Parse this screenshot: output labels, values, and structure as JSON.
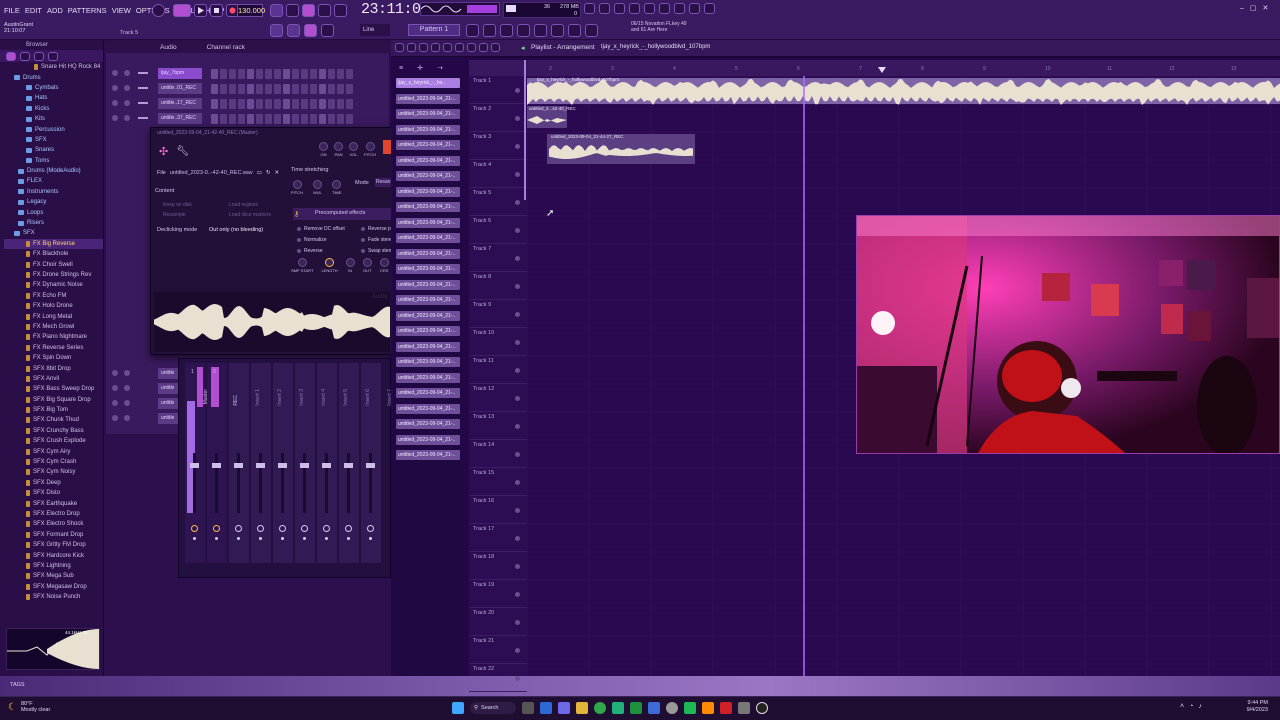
{
  "app": {
    "menu": [
      "FILE",
      "EDIT",
      "ADD",
      "PATTERNS",
      "VIEW",
      "OPTIONS",
      "TOOLS",
      "HELP"
    ],
    "user": "AustinGrant",
    "user_time": "21:10:07",
    "track_hint": "Track 5",
    "tempo": "130.000",
    "clock": "23:11:06",
    "monitor_a": "36",
    "monitor_b": "278 MB",
    "monitor_c": "0",
    "pattern": "Pattern 1",
    "snap": "Line",
    "hint": [
      "06/15  Novation FLkey 49",
      "and 61 Are Here"
    ]
  },
  "browser": {
    "title": "Browser",
    "items": [
      {
        "label": "Snare Hit HQ Rock 84",
        "type": "file"
      },
      {
        "label": "Drums",
        "type": "folder"
      },
      {
        "label": "Cymbals",
        "type": "folder"
      },
      {
        "label": "Hats",
        "type": "folder"
      },
      {
        "label": "Kicks",
        "type": "folder"
      },
      {
        "label": "Kits",
        "type": "folder"
      },
      {
        "label": "Percussion",
        "type": "folder"
      },
      {
        "label": "SFX",
        "type": "folder"
      },
      {
        "label": "Snares",
        "type": "folder"
      },
      {
        "label": "Toms",
        "type": "folder"
      },
      {
        "label": "Drums (ModeAudio)",
        "type": "folder"
      },
      {
        "label": "FLEX",
        "type": "folder"
      },
      {
        "label": "Instruments",
        "type": "folder"
      },
      {
        "label": "Legacy",
        "type": "folder"
      },
      {
        "label": "Loops",
        "type": "folder"
      },
      {
        "label": "Risers",
        "type": "folder"
      },
      {
        "label": "SFX",
        "type": "folder"
      },
      {
        "label": "FX Big Reverse",
        "type": "file",
        "selected": true
      },
      {
        "label": "FX Blackhole",
        "type": "file"
      },
      {
        "label": "FX Choir Swell",
        "type": "file"
      },
      {
        "label": "FX Drone Strings Rev",
        "type": "file"
      },
      {
        "label": "FX Dynamic Noise",
        "type": "file"
      },
      {
        "label": "FX Echo FM",
        "type": "file"
      },
      {
        "label": "FX Holo Drone",
        "type": "file"
      },
      {
        "label": "FX Long Metal",
        "type": "file"
      },
      {
        "label": "FX Mech Growl",
        "type": "file"
      },
      {
        "label": "FX Piano Nightmare",
        "type": "file"
      },
      {
        "label": "FX Reverse Series",
        "type": "file"
      },
      {
        "label": "FX Spin Down",
        "type": "file"
      },
      {
        "label": "SFX 8bit Drop",
        "type": "file"
      },
      {
        "label": "SFX Anvil",
        "type": "file"
      },
      {
        "label": "SFX Bass Sweep Drop",
        "type": "file"
      },
      {
        "label": "SFX Big Square Drop",
        "type": "file"
      },
      {
        "label": "SFX Big Tom",
        "type": "file"
      },
      {
        "label": "SFX Chunk Thud",
        "type": "file"
      },
      {
        "label": "SFX Crunchy Bass",
        "type": "file"
      },
      {
        "label": "SFX Crush Explode",
        "type": "file"
      },
      {
        "label": "SFX Cym Airy",
        "type": "file"
      },
      {
        "label": "SFX Cym Crash",
        "type": "file"
      },
      {
        "label": "SFX Cym Noisy",
        "type": "file"
      },
      {
        "label": "SFX Deep",
        "type": "file"
      },
      {
        "label": "SFX Disto",
        "type": "file"
      },
      {
        "label": "SFX Earthquake",
        "type": "file"
      },
      {
        "label": "SFX Electro Drop",
        "type": "file"
      },
      {
        "label": "SFX Electro Shock",
        "type": "file"
      },
      {
        "label": "SFX Formant Drop",
        "type": "file"
      },
      {
        "label": "SFX Gritty FM Drop",
        "type": "file"
      },
      {
        "label": "SFX Hardcore Kick",
        "type": "file"
      },
      {
        "label": "SFX Lightning",
        "type": "file"
      },
      {
        "label": "SFX Mega Sub",
        "type": "file"
      },
      {
        "label": "SFX Megasaw Drop",
        "type": "file"
      },
      {
        "label": "SFX Noise Punch",
        "type": "file"
      }
    ],
    "preview_info": "44.1kHz 32",
    "tags_label": "TAGS"
  },
  "channel_rack": {
    "tabs": [
      "Audio",
      "Channel rack"
    ],
    "rows": [
      "tjay_7bpm",
      "untitle..01_REC",
      "untitle..17_REC",
      "untitle..37_REC"
    ],
    "lower_rows": [
      "untitle",
      "untitle",
      "untitle",
      "untitle"
    ]
  },
  "sampler": {
    "title": "untitled_2023-09-04_21-42-40_REC (Master)",
    "file_label": "File",
    "file_name": "untitled_2023-0..-42-40_REC.wav",
    "knobs": [
      "PITCH",
      "MUL",
      "TIME"
    ],
    "top_knobs": [
      "ON",
      "PAN",
      "VOL",
      "PITCH"
    ],
    "content": "Content",
    "keep_on_disk": "Keep on disk",
    "resample": "Resample",
    "load_regions": "Load regions",
    "load_slice": "Load slice markers",
    "declick": "Declicking mode",
    "declick_value": "Out only (no bleeding)",
    "time_stretch": "Time stretching",
    "mode": "Mode",
    "resample_btn": "Resan",
    "precomputed": "Precomputed effects",
    "effects_left": [
      "Remove DC offset",
      "Normalize",
      "Reverse"
    ],
    "effects_right": [
      "Reverse p",
      "Fade stere",
      "Swap sten"
    ],
    "env_labels": [
      "SMP START",
      "LENGTH",
      "IN",
      "OUT",
      "CRS"
    ],
    "wave_watermark": "Audio"
  },
  "mixer": {
    "master": "Master",
    "insert": "REC",
    "inserts": [
      "Insert 1",
      "Insert 2",
      "Insert 3",
      "Insert 4",
      "Insert 5",
      "Insert 6",
      "Insert 7"
    ],
    "numbers": [
      "1",
      "2"
    ]
  },
  "playlist": {
    "title": "Playlist - Arrangement",
    "breadcrumb": "tjay_x_heyrick_-_hollywoodblvd_107bpm",
    "picker": [
      "tjay_x_heyrick_-_ho..",
      "untitled_2023-09-04_21-..",
      "untitled_2023-09-04_21-..",
      "untitled_2023-09-04_21-..",
      "untitled_2023-09-04_21-..",
      "untitled_2023-09-04_21-..",
      "untitled_2023-09-04_21-..",
      "untitled_2023-09-04_21-..",
      "untitled_2023-09-04_21-..",
      "untitled_2023-09-04_21-..",
      "untitled_2023-09-04_21-..",
      "untitled_2023-09-04_21-..",
      "untitled_2023-09-04_21-..",
      "untitled_2023-09-04_21-..",
      "untitled_2023-09-04_21-..",
      "untitled_2023-09-04_21-..",
      "untitled_2023-09-04_21-..",
      "untitled_2023-09-04_21-..",
      "untitled_2023-09-04_21-..",
      "untitled_2023-09-04_21-..",
      "untitled_2023-09-04_21-..",
      "untitled_2023-09-04_21-..",
      "untitled_2023-09-04_21-..",
      "untitled_2023-09-04_21-..",
      "untitled_2023-09-04_21-.."
    ],
    "tracks": [
      "Track 1",
      "Track 2",
      "Track 3",
      "Track 4",
      "Track 5",
      "Track 6",
      "Track 7",
      "Track 8",
      "Track 9",
      "Track 10",
      "Track 11",
      "Track 12",
      "Track 13",
      "Track 14",
      "Track 15",
      "Track 16",
      "Track 17",
      "Track 18",
      "Track 19",
      "Track 20",
      "Track 21",
      "Track 22"
    ],
    "ruler": [
      "2",
      "3",
      "4",
      "5",
      "6",
      "7",
      "8",
      "9",
      "10",
      "11",
      "12",
      "13"
    ],
    "clip1": "tjay_x_heyrick_-_hollywoodblvd_107bpm",
    "clip2": "untitled_2...42-40_REC",
    "clip3": "untitled_2023-09-04_21-44-27_REC"
  },
  "taskbar": {
    "weather_temp": "80°F",
    "weather_desc": "Mostly clear",
    "search": "Search",
    "time": "9:44 PM",
    "date": "9/4/2023"
  },
  "colors": {
    "accent": "#a36ae6",
    "playhead": "#b06bff",
    "waveform": "#e8e1d2"
  }
}
